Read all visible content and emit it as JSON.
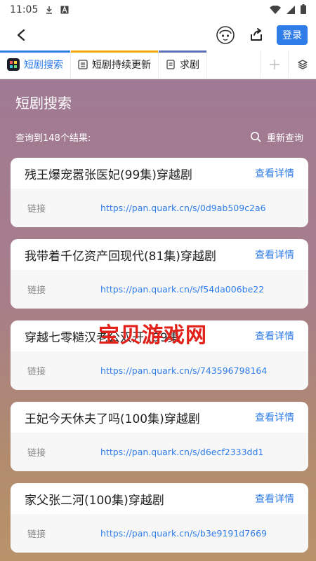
{
  "statusbar": {
    "time": "11:05"
  },
  "topbar": {
    "login_label": "登录"
  },
  "tabs": [
    {
      "label": "短剧搜索",
      "bar_color": "#2f7de9"
    },
    {
      "label": "短剧持续更新",
      "bar_color": "#f2a900"
    },
    {
      "label": "求剧",
      "bar_color": "#5a6fb5"
    }
  ],
  "page": {
    "title": "短剧搜索",
    "result_count": "查询到148个结果:",
    "requery_label": "重新查询"
  },
  "results": [
    {
      "title": "残王爆宠嚣张医妃(99集)穿越剧",
      "detail_label": "查看详情",
      "link_label": "链接",
      "url": "https://pan.quark.cn/s/0d9ab509c2a6"
    },
    {
      "title": "我带着千亿资产回现代(81集)穿越剧",
      "detail_label": "查看详情",
      "link_label": "链接",
      "url": "https://pan.quark.cn/s/f54da006be22"
    },
    {
      "title": "穿越七零糙汉老公双开 (99集",
      "detail_label": "查看详情",
      "link_label": "链接",
      "url": "https://pan.quark.cn/s/743596798164"
    },
    {
      "title": "王妃今天休夫了吗(100集)穿越剧",
      "detail_label": "查看详情",
      "link_label": "链接",
      "url": "https://pan.quark.cn/s/d6ecf2333dd1"
    },
    {
      "title": "家父张二河(100集)穿越剧",
      "detail_label": "查看详情",
      "link_label": "链接",
      "url": "https://pan.quark.cn/s/b3e9191d7669"
    }
  ],
  "watermark": "宝贝游戏网",
  "colors": {
    "accent": "#2f7de9",
    "gradient_top": "#a07a94",
    "gradient_bottom": "#b8936a"
  }
}
